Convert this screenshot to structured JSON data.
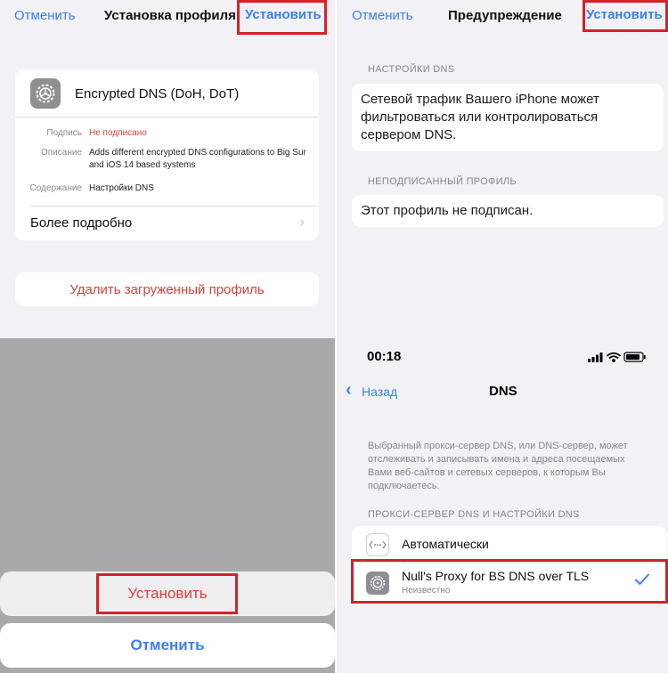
{
  "install_profile": {
    "nav": {
      "cancel": "Отменить",
      "title": "Установка профиля",
      "install": "Установить"
    },
    "profile_name": "Encrypted DNS (DoH, DoT)",
    "details": [
      {
        "label": "Подпись",
        "value": "Не подписано"
      },
      {
        "label": "Описание",
        "value": "Adds different encrypted DNS configurations to Big Sur and iOS 14 based systems"
      },
      {
        "label": "Содержание",
        "value": "Настройки DNS"
      }
    ],
    "more": "Более подробно",
    "remove": "Удалить загруженный профиль"
  },
  "warning": {
    "nav": {
      "cancel": "Отменить",
      "title": "Предупреждение",
      "install": "Установить"
    },
    "sections": [
      {
        "header": "НАСТРОЙКИ DNS",
        "text": "Сетевой трафик Вашего iPhone может фильтроваться или контролироваться сервером DNS."
      },
      {
        "header": "НЕПОДПИСАННЫЙ ПРОФИЛЬ",
        "text": "Этот профиль не подписан."
      }
    ]
  },
  "action_sheet": {
    "install": "Установить",
    "cancel": "Отменить"
  },
  "dns_settings": {
    "time": "00:18",
    "back": "Назад",
    "title": "DNS",
    "description": "Выбранный прокси-сервер DNS, или DNS-сервер, может отслеживать и записывать имена и адреса посещаемых Вами веб-сайтов и сетевых серверов, к которым Вы подключаетесь.",
    "section_header": "ПРОКСИ-СЕРВЕР DNS И НАСТРОЙКИ DNS",
    "options": [
      {
        "name": "Автоматически",
        "icon": "dots-arrows-icon"
      },
      {
        "name": "Null's Proxy for BS DNS over TLS",
        "subtitle": "Неизвестно",
        "icon": "gear-icon",
        "selected": true
      }
    ]
  },
  "colors": {
    "accent": "#3b7ff0",
    "destructive": "#d9413a",
    "highlight_box": "#d6202a"
  }
}
